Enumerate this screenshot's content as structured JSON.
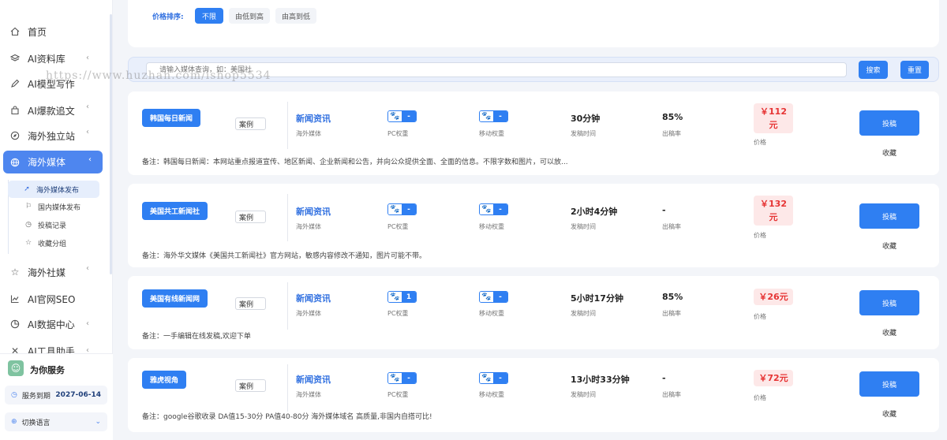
{
  "sidebar": {
    "items": [
      {
        "label": "首页",
        "icon": "home-icon"
      },
      {
        "label": "AI资料库",
        "icon": "layers-icon"
      },
      {
        "label": "AI模型写作",
        "icon": "pen-icon"
      },
      {
        "label": "AI爆款追文",
        "icon": "bag-icon"
      },
      {
        "label": "海外独立站",
        "icon": "compass-icon"
      },
      {
        "label": "海外媒体",
        "icon": "globe-icon"
      },
      {
        "label": "海外社媒",
        "icon": "star-icon"
      },
      {
        "label": "AI官网SEO",
        "icon": "chart-line-icon"
      },
      {
        "label": "AI数据中心",
        "icon": "pie-icon"
      },
      {
        "label": "AI工具助手",
        "icon": "tools-icon"
      }
    ],
    "sub_items": [
      {
        "label": "海外媒体发布",
        "icon": "send-icon"
      },
      {
        "label": "国内媒体发布",
        "icon": "flag-icon"
      },
      {
        "label": "投稿记录",
        "icon": "history-icon"
      },
      {
        "label": "收藏分组",
        "icon": "star-outline-icon"
      }
    ],
    "footer": {
      "title": "为你服务",
      "expire_label": "服务到期",
      "expire_date": "2027-06-14",
      "language_label": "切换语言"
    }
  },
  "filter": {
    "label": "价格排序:",
    "options": [
      "不限",
      "由低到高",
      "由高到低"
    ]
  },
  "search": {
    "placeholder": "请输入媒体查询，如：美国社",
    "search_label": "搜索",
    "reset_label": "重置"
  },
  "watermark": "https://www.huzhan.com/ishop5534",
  "labels": {
    "case": "案例",
    "category": "海外媒体",
    "pc_weight": "PC权重",
    "mobile_weight": "移动权重",
    "publish_time": "发稿时间",
    "rate": "出稿率",
    "price": "价格",
    "submit": "投稿",
    "favorite": "收藏"
  },
  "cards": [
    {
      "name": "韩国每日新闻",
      "category": "新闻资讯",
      "pc": "-",
      "mobile": "-",
      "time": "30分钟",
      "rate": "85%",
      "price": "￥112\n元",
      "note": "备注：韩国每日新闻：本网站重点报道宣传、地区新闻、企业新闻和公告，并向公众提供全面、全面的信息。不限字数和图片，可以放..."
    },
    {
      "name": "美国共工新闻社",
      "category": "新闻资讯",
      "pc": "-",
      "mobile": "-",
      "time": "2小时4分钟",
      "rate": "-",
      "price": "￥132\n元",
      "note": "备注：海外华文媒体《美国共工新闻社》官方网站，敏感内容修改不通知，图片可能不带。"
    },
    {
      "name": "美国有线新闻网",
      "category": "新闻资讯",
      "pc": "1",
      "mobile": "-",
      "time": "5小时17分钟",
      "rate": "85%",
      "price": "￥26元",
      "note": "备注：一手编辑在线发稿,欢迎下单"
    },
    {
      "name": "雅虎视角",
      "category": "新闻资讯",
      "pc": "-",
      "mobile": "-",
      "time": "13小时33分钟",
      "rate": "-",
      "price": "￥72元",
      "note": "备注：google谷歌收录 DA值15-30分 PA值40-80分 海外媒体域名 高质量,非国内自搭可比!"
    }
  ]
}
